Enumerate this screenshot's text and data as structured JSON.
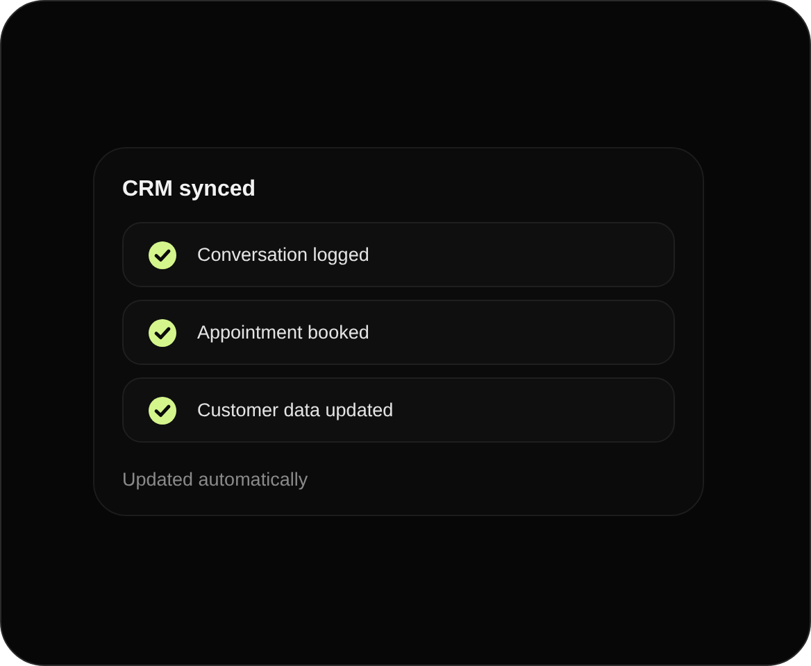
{
  "card": {
    "title": "CRM synced",
    "items": [
      {
        "label": "Conversation logged",
        "checked": true
      },
      {
        "label": "Appointment booked",
        "checked": true
      },
      {
        "label": "Customer data updated",
        "checked": true
      }
    ],
    "footer": "Updated automatically"
  }
}
